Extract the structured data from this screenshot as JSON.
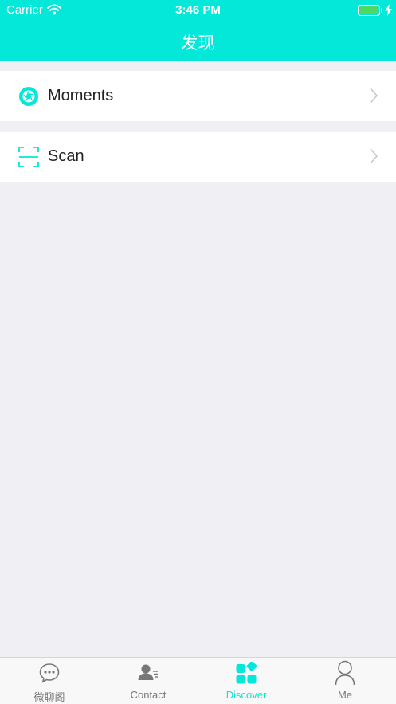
{
  "status_bar": {
    "carrier": "Carrier",
    "time": "3:46 PM"
  },
  "nav": {
    "title": "发现"
  },
  "cells": [
    {
      "label": "Moments",
      "icon": "moments-icon"
    },
    {
      "label": "Scan",
      "icon": "scan-icon"
    }
  ],
  "tab_bar": {
    "items": [
      {
        "label": "微聊阁",
        "icon": "chat-bubble-icon",
        "active": false
      },
      {
        "label": "Contact",
        "icon": "contact-icon",
        "active": false
      },
      {
        "label": "Discover",
        "icon": "discover-icon",
        "active": true
      },
      {
        "label": "Me",
        "icon": "person-icon",
        "active": false
      }
    ]
  },
  "colors": {
    "accent": "#03e8d9",
    "background": "#efeff4",
    "inactive": "#777777",
    "battery": "#4cd964"
  }
}
